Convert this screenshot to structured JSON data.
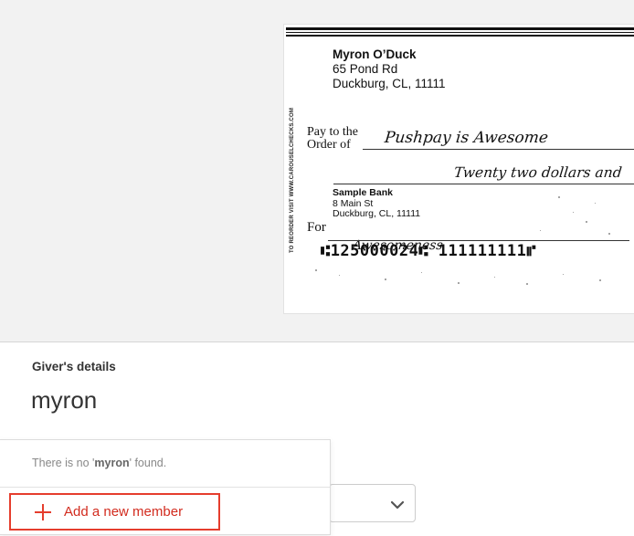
{
  "check": {
    "drawer_name": "Myron O’Duck",
    "drawer_address_1": "65 Pond Rd",
    "drawer_address_2": "Duckburg, CL, 11111",
    "reorder_text": "TO REORDER VISIT WWW.CAROUSELCHECKS.COM",
    "pay_to_line1": "Pay to the",
    "pay_to_line2": "Order of",
    "payee": "Pushpay is Awesome",
    "amount_words": "Twenty two dollars and",
    "bank_name": "Sample Bank",
    "bank_address_1": "8 Main St",
    "bank_address_2": "Duckburg, CL, 11111",
    "for_label": "For",
    "memo": "Awesomeness",
    "micr": "⑆125000024⑆ 111111111⑈"
  },
  "form": {
    "givers_label": "Giver's details",
    "giver_value": "myron"
  },
  "dropdown": {
    "no_result_prefix": "There is no '",
    "no_result_term": "myron",
    "no_result_suffix": "' found.",
    "add_member_label": "Add a new member"
  },
  "colors": {
    "accent_red": "#e53d2d",
    "background": "#f2f2f2"
  },
  "icons": {
    "select_chevron": "chevron-down-icon",
    "add_icon": "plus-icon"
  }
}
